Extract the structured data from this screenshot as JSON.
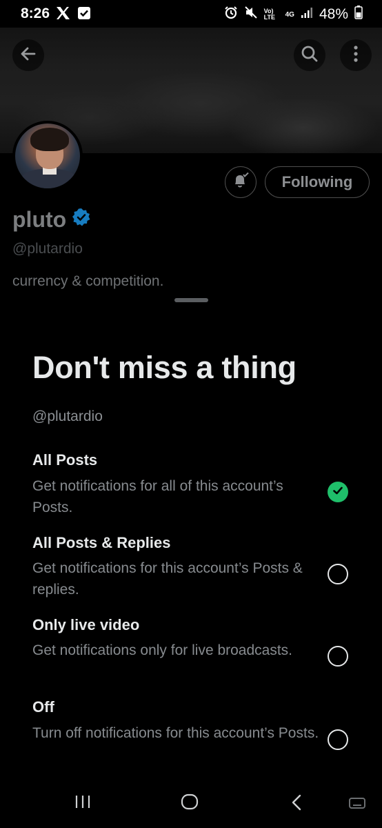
{
  "status_bar": {
    "time": "8:26",
    "network": "Vo) LTE",
    "network_type": "4G",
    "battery": "48%"
  },
  "header": {
    "back_icon": "back-arrow-icon",
    "search_icon": "search-icon",
    "more_icon": "more-vertical-icon"
  },
  "profile": {
    "name": "pluto",
    "handle": "@plutardio",
    "bio": "currency & competition.",
    "following_label": "Following",
    "verified_color": "#1d9bf0"
  },
  "sheet": {
    "title": "Don't miss a thing",
    "handle": "@plutardio",
    "options": [
      {
        "title": "All Posts",
        "description": "Get notifications for all of this account’s Posts.",
        "selected": true
      },
      {
        "title": "All Posts & Replies",
        "description": "Get notifications for this account’s Posts & replies.",
        "selected": false
      },
      {
        "title": "Only live video",
        "description": "Get notifications only for live broadcasts.",
        "selected": false
      },
      {
        "title": "Off",
        "description": "Turn off notifications for this account’s Posts.",
        "selected": false
      }
    ],
    "selected_color": "#1fbf6a"
  },
  "nav": {
    "recents_icon": "recent-apps-icon",
    "home_icon": "home-icon",
    "back_icon": "back-icon",
    "keyboard_icon": "keyboard-toggle-icon"
  }
}
